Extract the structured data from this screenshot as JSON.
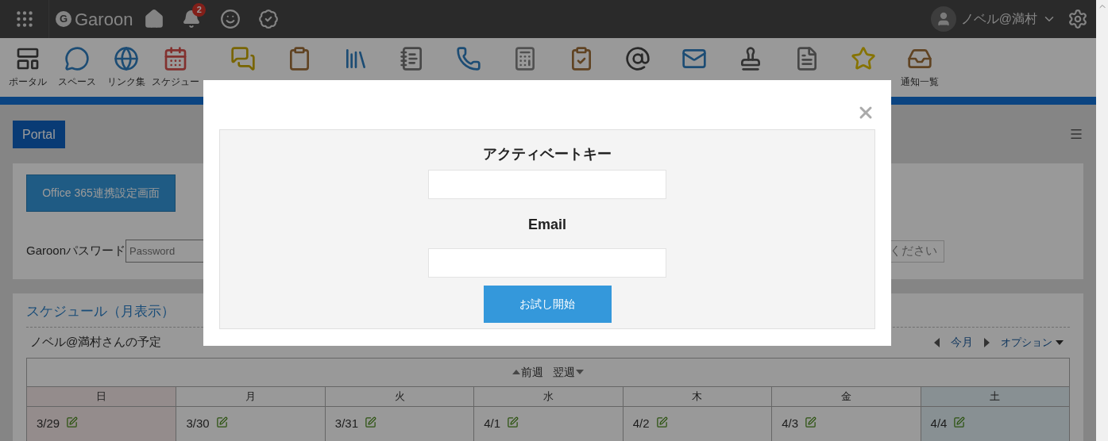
{
  "header": {
    "logo": {
      "mark": "G",
      "name": "Garoon"
    },
    "notification_count": "2",
    "user": {
      "name": "ノベル@満村"
    }
  },
  "toolbar": {
    "items": [
      {
        "kind": "portal",
        "label": "ポータル"
      },
      {
        "kind": "space",
        "label": "スペース"
      },
      {
        "kind": "link",
        "label": "リンク集"
      },
      {
        "kind": "schedule",
        "label": "スケジュー"
      },
      {
        "kind": "message"
      },
      {
        "kind": "bulletin"
      },
      {
        "kind": "cabinet"
      },
      {
        "kind": "memo"
      },
      {
        "kind": "phone"
      },
      {
        "kind": "timecard"
      },
      {
        "kind": "todo"
      },
      {
        "kind": "address"
      },
      {
        "kind": "mail"
      },
      {
        "kind": "workflow"
      },
      {
        "kind": "report"
      },
      {
        "kind": "favorite"
      },
      {
        "kind": "notification",
        "label": "通知一覧"
      }
    ]
  },
  "portal_tab": {
    "label": "Portal",
    "selected": true
  },
  "settings_panel": {
    "button": "Office 365連携設定画面",
    "password_label": "Garoonパスワード",
    "password_placeholder": "Password",
    "trailing_field": "ください"
  },
  "schedule": {
    "title": "スケジュール（月表示）",
    "owner": "ノベル@満村さんの予定",
    "today": "今月",
    "options": "オプション",
    "prev_week": "前週",
    "next_week": "翌週",
    "days": [
      {
        "name": "日",
        "date": "3/29",
        "kind": "sunday"
      },
      {
        "name": "月",
        "date": "3/30",
        "kind": "weekday"
      },
      {
        "name": "火",
        "date": "3/31",
        "kind": "weekday"
      },
      {
        "name": "水",
        "date": "4/1",
        "kind": "weekday"
      },
      {
        "name": "木",
        "date": "4/2",
        "kind": "weekday"
      },
      {
        "name": "金",
        "date": "4/3",
        "kind": "weekday"
      },
      {
        "name": "土",
        "date": "4/4",
        "kind": "saturday"
      }
    ]
  },
  "dialog": {
    "key_label": "アクティベートキー",
    "email_label": "Email",
    "submit": "お試し開始"
  }
}
